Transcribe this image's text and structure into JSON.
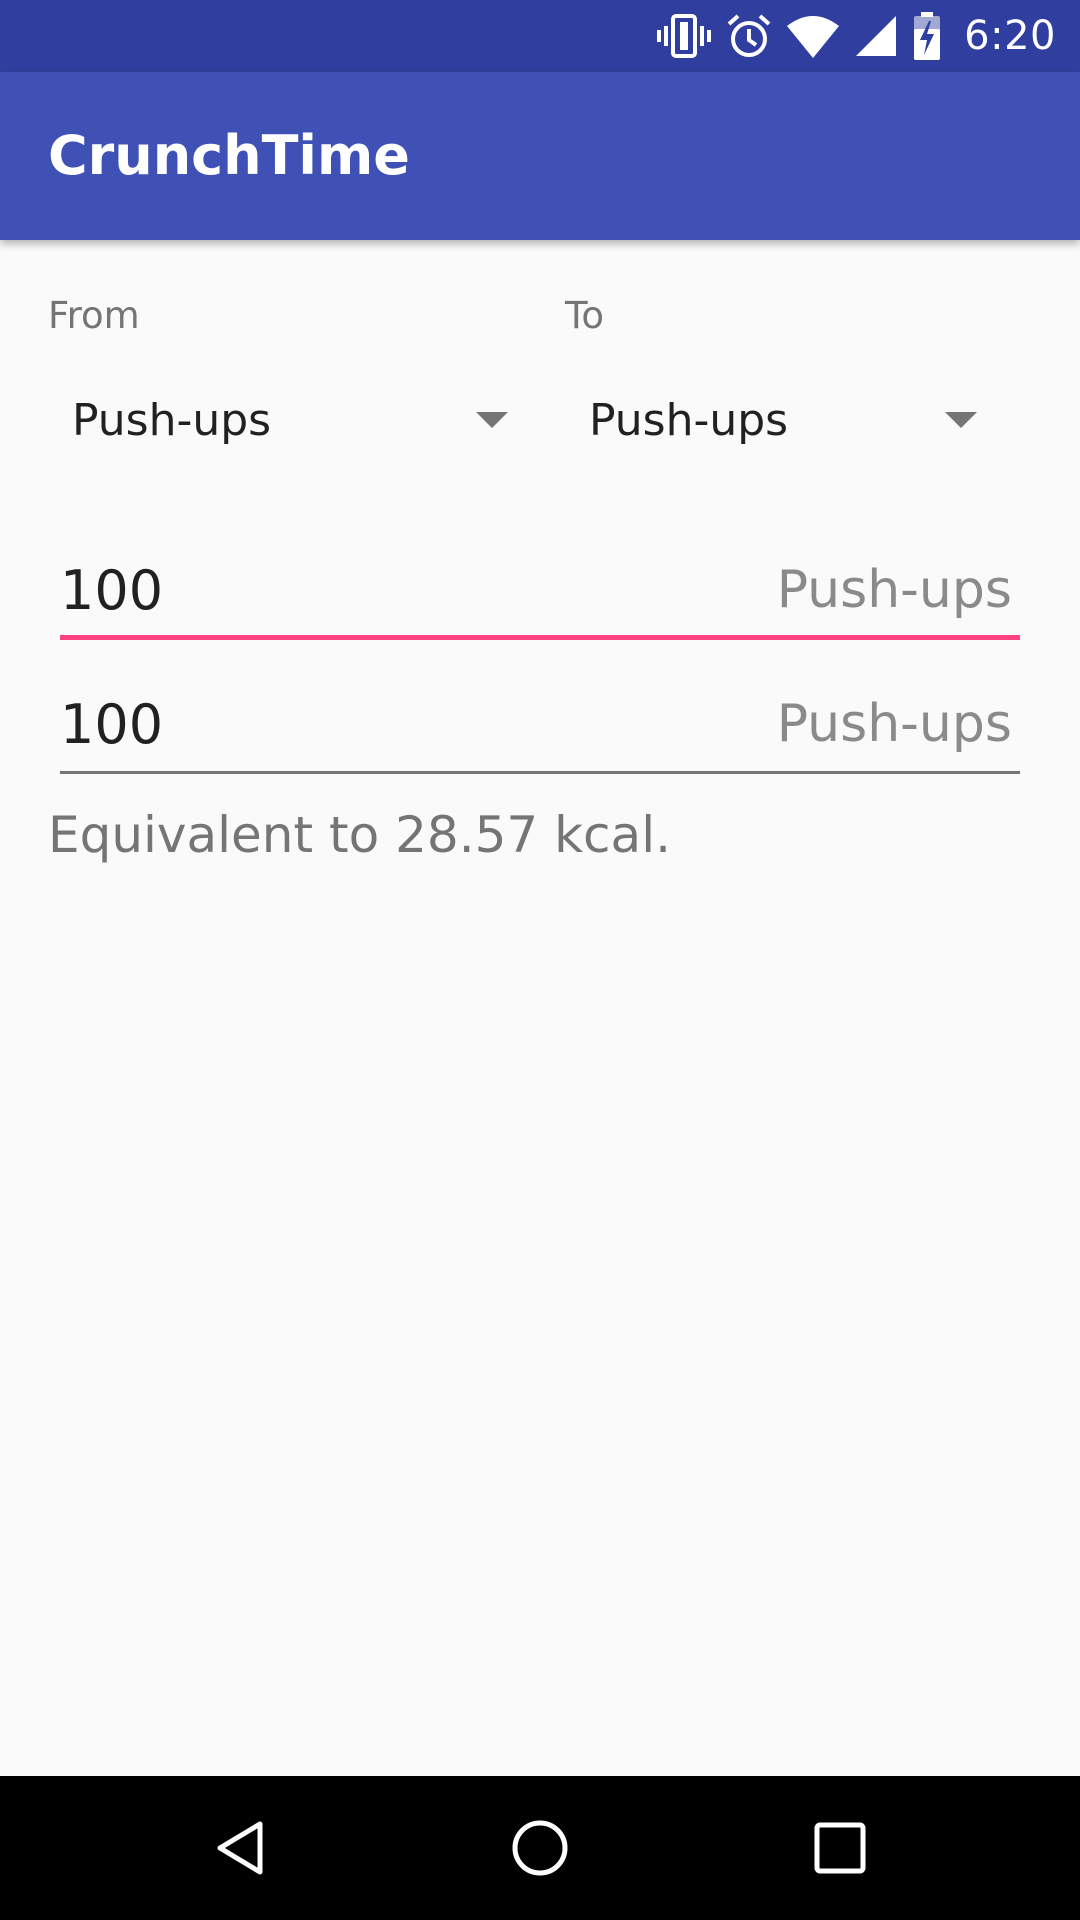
{
  "status_bar": {
    "time": "6:20",
    "icons": [
      "vibrate-icon",
      "alarm-icon",
      "wifi-icon",
      "cell-signal-icon",
      "battery-charging-icon"
    ]
  },
  "app_bar": {
    "title": "CrunchTime"
  },
  "converter": {
    "from_label": "From",
    "to_label": "To",
    "from_exercise": "Push-ups",
    "to_exercise": "Push-ups",
    "input_value": "100",
    "input_unit": "Push-ups",
    "output_value": "100",
    "output_unit": "Push-ups",
    "result": "Equivalent to 28.57 kcal."
  },
  "colors": {
    "status_bar": "#303f9f",
    "app_bar": "#3f51b5",
    "accent": "#ff4081",
    "background": "#fafafa"
  },
  "nav_bar": {
    "buttons": [
      "back-icon",
      "home-icon",
      "recents-icon"
    ]
  }
}
